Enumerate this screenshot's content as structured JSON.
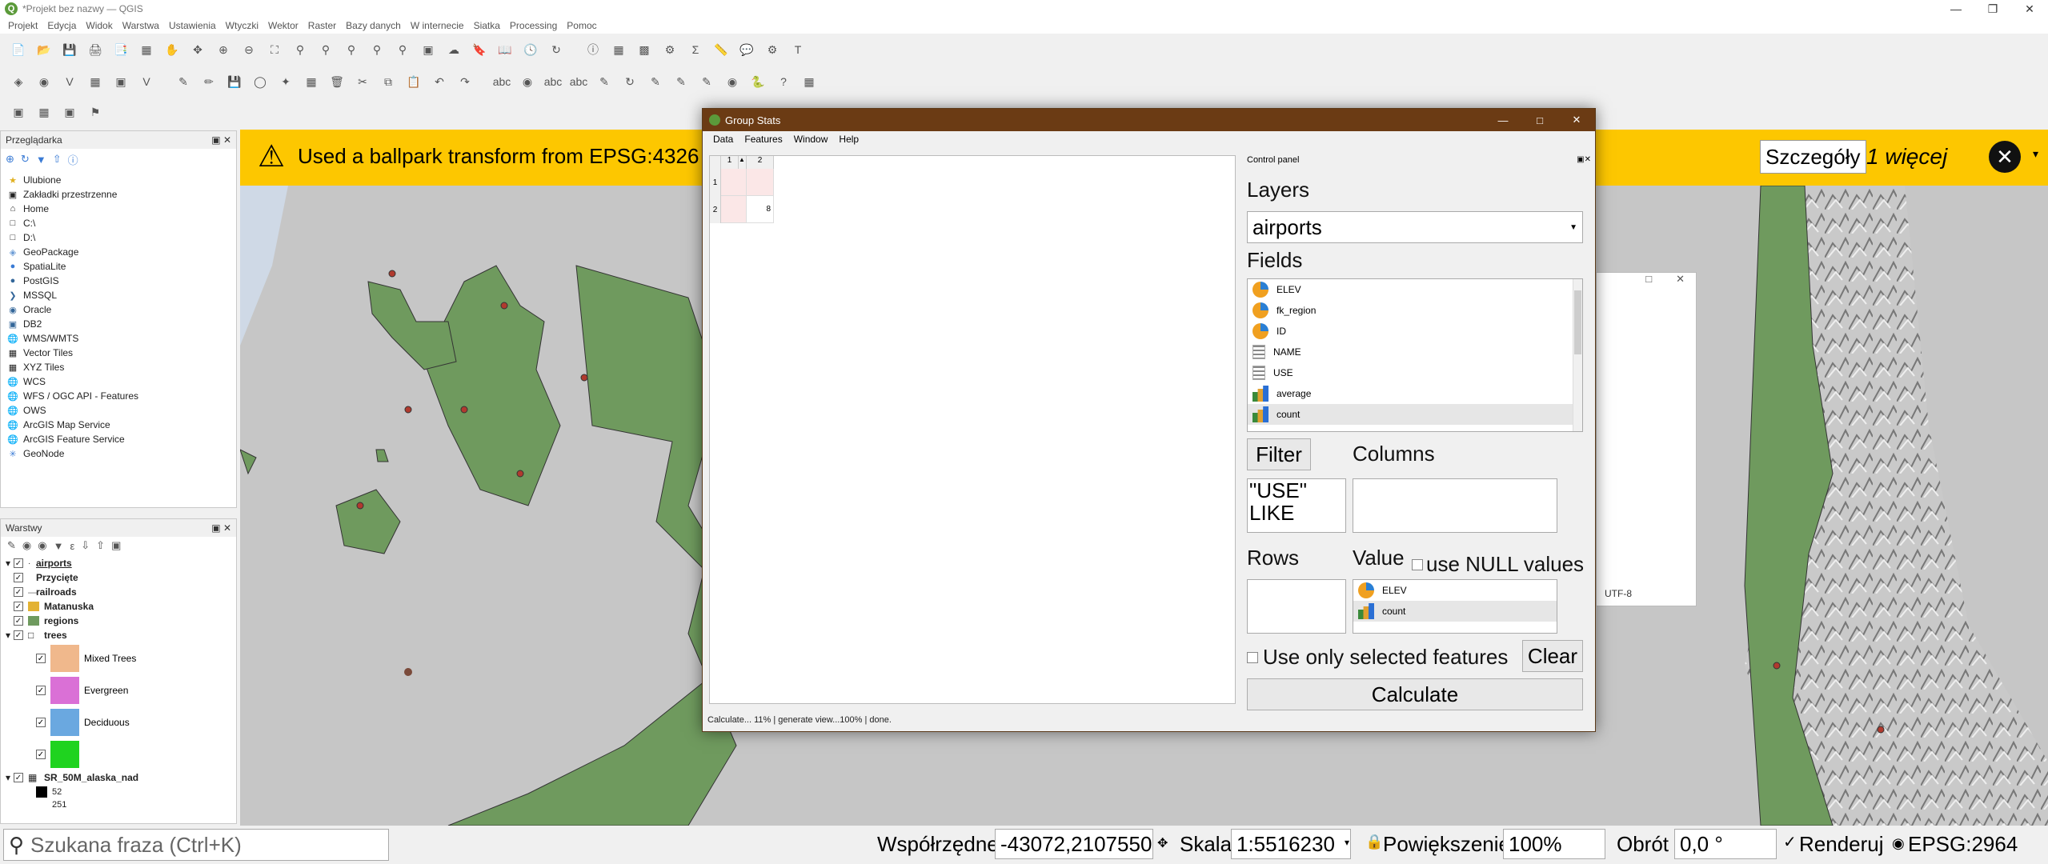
{
  "app": {
    "title": "*Projekt bez nazwy — QGIS"
  },
  "menu": [
    "Projekt",
    "Edycja",
    "Widok",
    "Warstwa",
    "Ustawienia",
    "Wtyczki",
    "Wektor",
    "Raster",
    "Bazy danych",
    "W internecie",
    "Siatka",
    "Processing",
    "Pomoc"
  ],
  "browser": {
    "title": "Przeglądarka",
    "items": [
      "Ulubione",
      "Zakładki przestrzenne",
      "Home",
      "C:\\",
      "D:\\",
      "GeoPackage",
      "SpatiaLite",
      "PostGIS",
      "MSSQL",
      "Oracle",
      "DB2",
      "WMS/WMTS",
      "Vector Tiles",
      "XYZ Tiles",
      "WCS",
      "WFS / OGC API - Features",
      "OWS",
      "ArcGIS Map Service",
      "ArcGIS Feature Service",
      "GeoNode"
    ]
  },
  "layers": {
    "title": "Warstwy",
    "items": [
      "airports",
      "Przycięte",
      "railroads",
      "Matanuska",
      "regions",
      "trees"
    ],
    "legend": [
      "Mixed Trees",
      "Evergreen",
      "Deciduous",
      ""
    ],
    "raster": "SR_50M_alaska_nad",
    "raster_vals": [
      "52",
      "251"
    ],
    "colors": {
      "matanuska": "#e3b233",
      "regions": "#6f9a5e",
      "mixed": "#f0b88c",
      "evergreen": "#da70d6",
      "deciduous": "#6aa8e0",
      "blank": "#1fd31f"
    }
  },
  "banner": {
    "message": "Used a ballpark transform from EPSG:4326",
    "details": "Szczegóły",
    "more": "1 więcej",
    "color": "#fdc700"
  },
  "dialog": {
    "title": "Group Stats",
    "menu": [
      "Data",
      "Features",
      "Window",
      "Help"
    ],
    "table": {
      "cols": [
        "1",
        "2"
      ],
      "rows": [
        "1",
        "2"
      ],
      "value": "8"
    },
    "status": "Calculate... 11% |  generate view...100% |  done.",
    "control_panel": "Control panel",
    "layers_label": "Layers",
    "layer_value": "airports",
    "fields_label": "Fields",
    "fields": [
      "ELEV",
      "fk_region",
      "ID",
      "NAME",
      "USE",
      "average",
      "count"
    ],
    "filter_label": "Filter",
    "filter_value": "\"USE\" LIKE",
    "columns_label": "Columns",
    "rows_label": "Rows",
    "value_label": "Value",
    "null_label": "use NULL values",
    "value_items": [
      "ELEV",
      "count"
    ],
    "selected_label": "Use only selected features",
    "clear": "Clear",
    "calculate": "Calculate"
  },
  "background_dialog": {
    "encoding": "UTF-8"
  },
  "statusbar": {
    "search_placeholder": "Szukana fraza (Ctrl+K)",
    "coord_label": "Współrzędne",
    "coord_value": "-43072,2107550",
    "scale_label": "Skala",
    "scale_value": "1:5516230",
    "zoom_label": "Powiększenie",
    "zoom_value": "100%",
    "rotation_label": "Obrót",
    "rotation_value": "0,0 °",
    "render_label": "Renderuj",
    "crs": "EPSG:2964"
  }
}
